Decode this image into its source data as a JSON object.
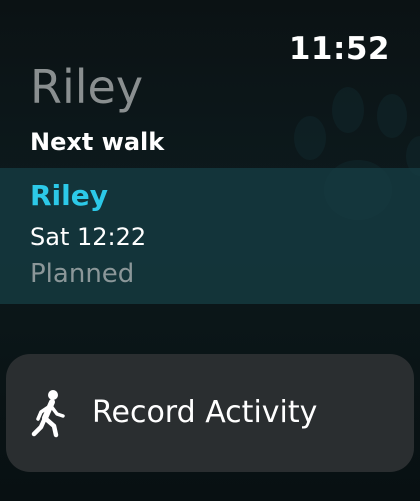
{
  "status_bar": {
    "time": "11:52"
  },
  "app": {
    "title": "Riley"
  },
  "next_walk": {
    "section_title": "Next walk",
    "dog_name": "Riley",
    "scheduled_time": "Sat 12:22",
    "status": "Planned"
  },
  "actions": {
    "record_label": "Record Activity",
    "record_icon": "walking-person-icon"
  },
  "background": {
    "decoration_icon": "paw-print-icon"
  },
  "colors": {
    "accent": "#2cc9e8",
    "card_background": "#163c42",
    "button_background": "#2a2e30",
    "muted_text": "#8a8f90"
  }
}
